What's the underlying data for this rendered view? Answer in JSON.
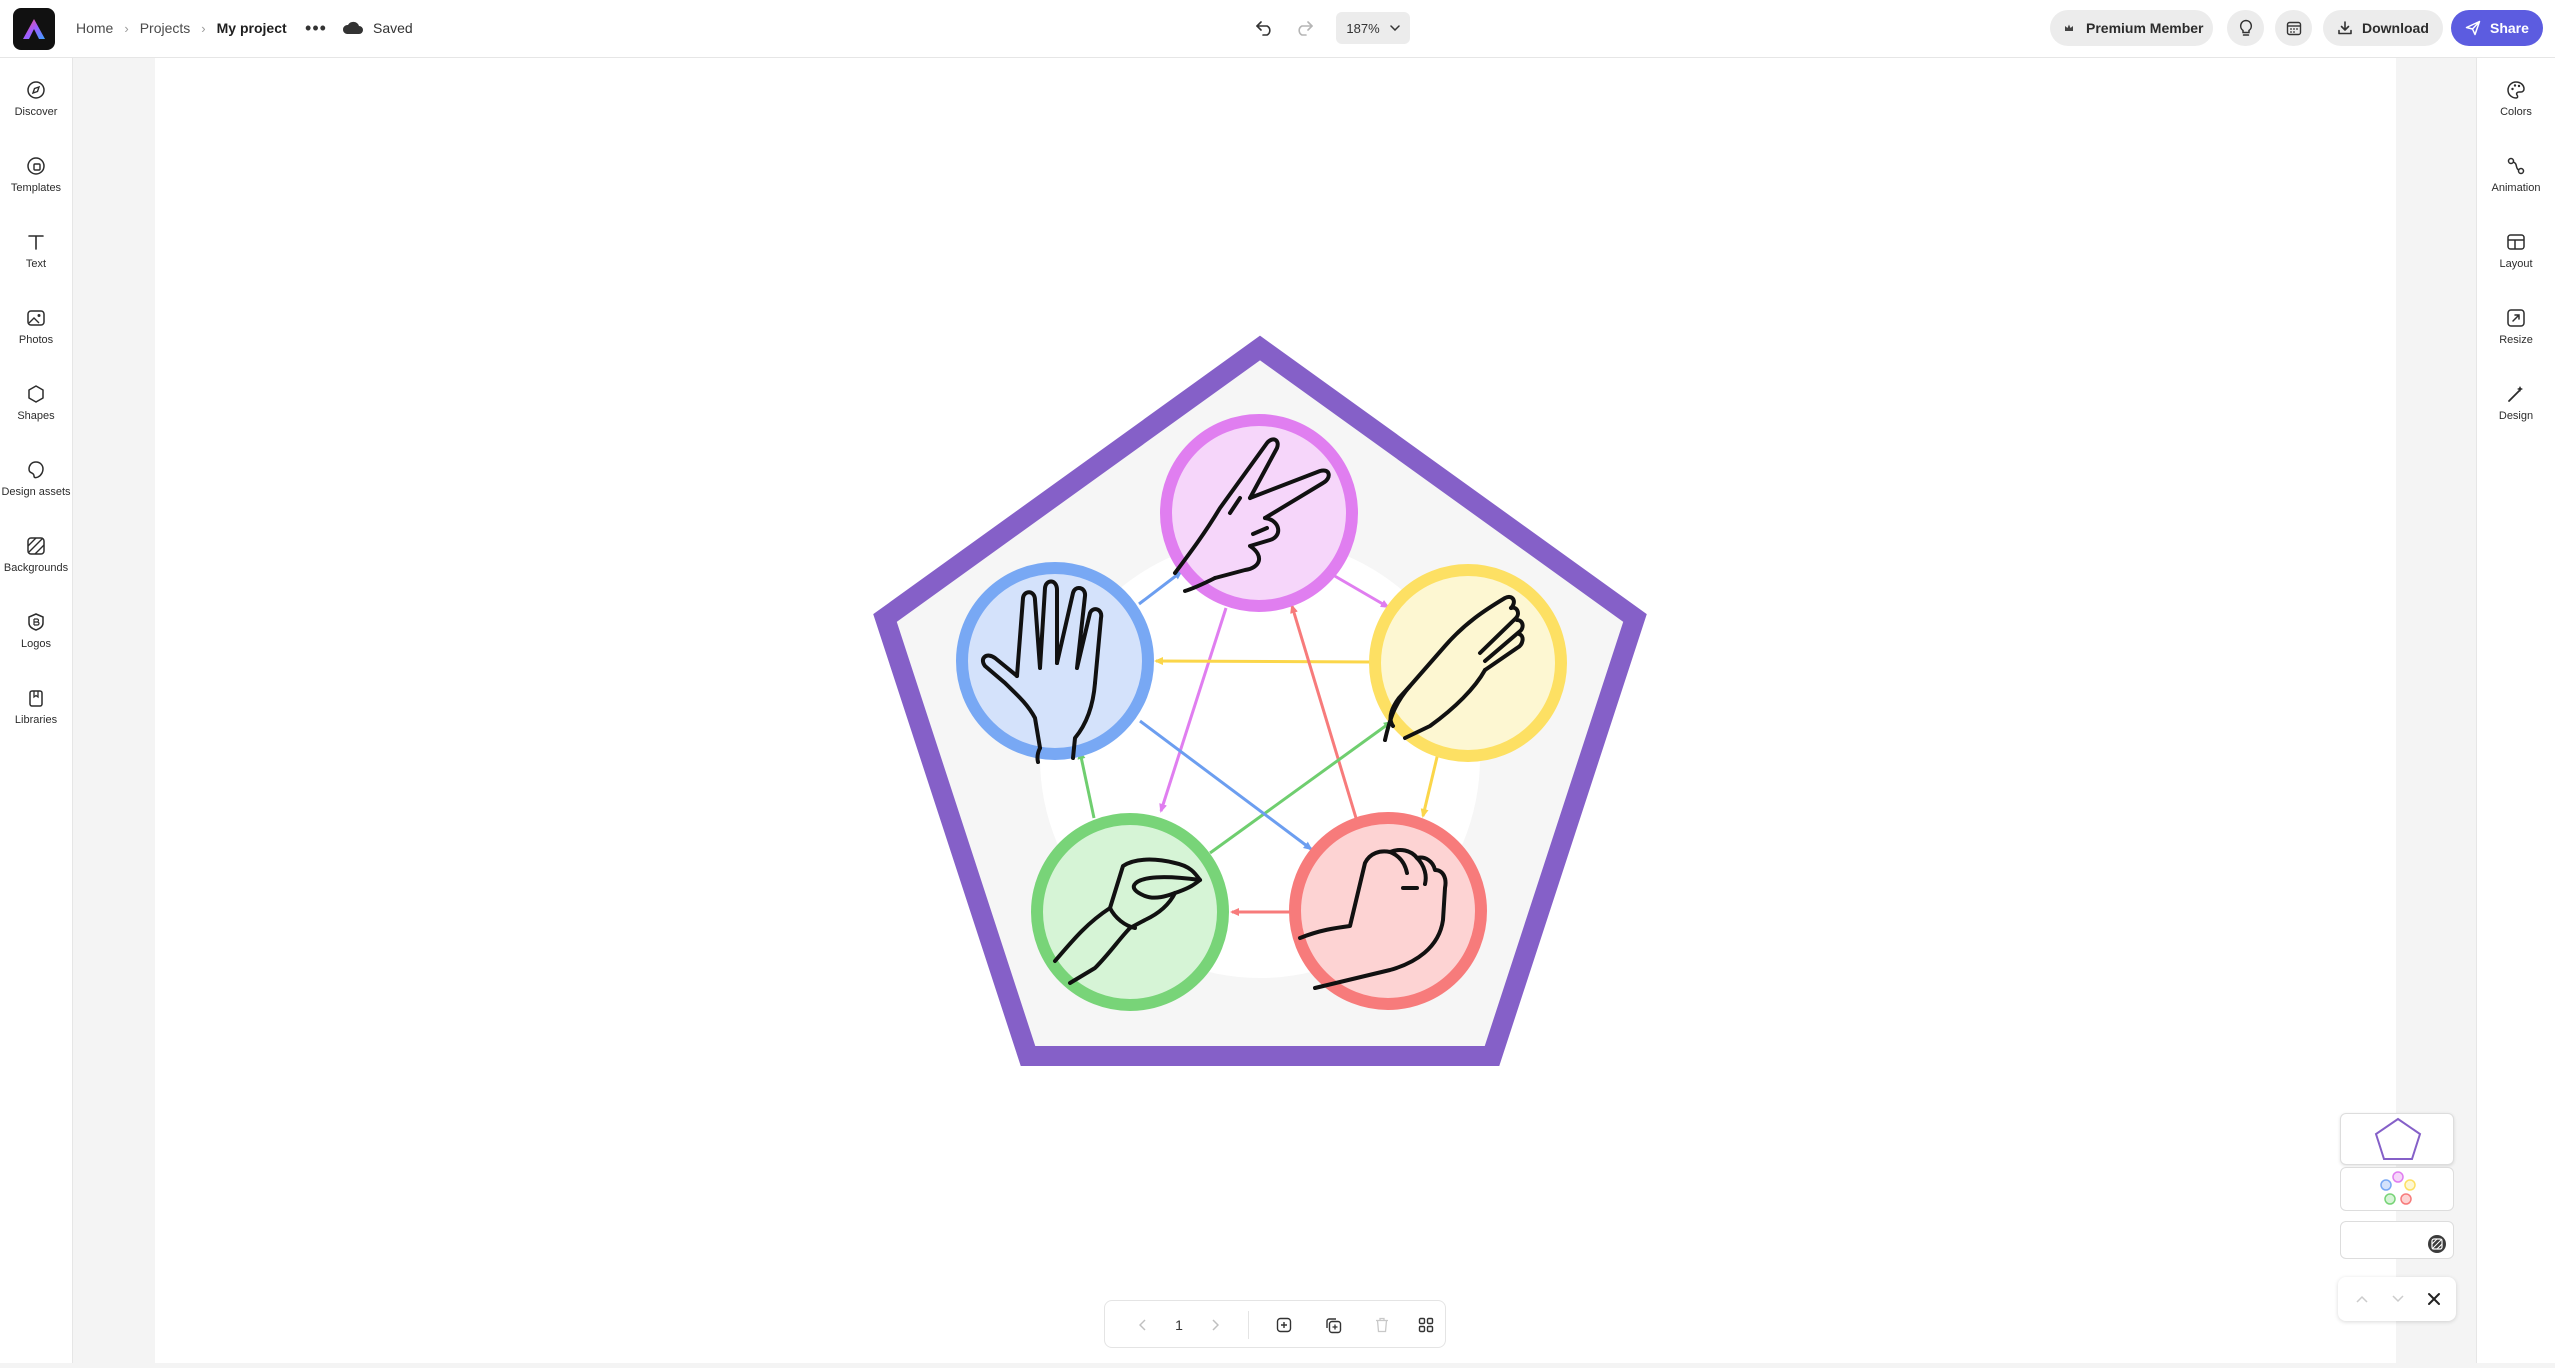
{
  "topbar": {
    "breadcrumb": [
      "Home",
      "Projects",
      "My project"
    ],
    "more_label": "•••",
    "save_status": "Saved",
    "zoom": "187%",
    "premium_label": "Premium Member",
    "download_label": "Download",
    "share_label": "Share"
  },
  "left_nav": [
    {
      "label": "Discover",
      "icon": "discover-icon"
    },
    {
      "label": "Templates",
      "icon": "templates-icon"
    },
    {
      "label": "Text",
      "icon": "text-icon"
    },
    {
      "label": "Photos",
      "icon": "photos-icon"
    },
    {
      "label": "Shapes",
      "icon": "shapes-icon"
    },
    {
      "label": "Design assets",
      "icon": "design-assets-icon"
    },
    {
      "label": "Backgrounds",
      "icon": "backgrounds-icon"
    },
    {
      "label": "Logos",
      "icon": "logos-icon"
    },
    {
      "label": "Libraries",
      "icon": "libraries-icon"
    }
  ],
  "right_nav": [
    {
      "label": "Colors",
      "icon": "palette-icon"
    },
    {
      "label": "Animation",
      "icon": "animation-icon"
    },
    {
      "label": "Layout",
      "icon": "layout-icon"
    },
    {
      "label": "Resize",
      "icon": "resize-icon"
    },
    {
      "label": "Design",
      "icon": "magic-wand-icon"
    }
  ],
  "page_bar": {
    "page_number": "1"
  },
  "diagram": {
    "pentagon_color": "#8560c8",
    "nodes": [
      {
        "name": "scissors",
        "ring": "#e07ef0",
        "fill": "#f6d6fa"
      },
      {
        "name": "paper",
        "ring": "#fde063",
        "fill": "#fdf7d2"
      },
      {
        "name": "rock",
        "ring": "#f77b7b",
        "fill": "#fdd3d3"
      },
      {
        "name": "lizard",
        "ring": "#78d478",
        "fill": "#d6f4d6"
      },
      {
        "name": "spock",
        "ring": "#78a8f4",
        "fill": "#d4e2fb"
      }
    ]
  },
  "colors": {
    "accent": "#5c5ce0",
    "pentagon": "#8560c8"
  }
}
